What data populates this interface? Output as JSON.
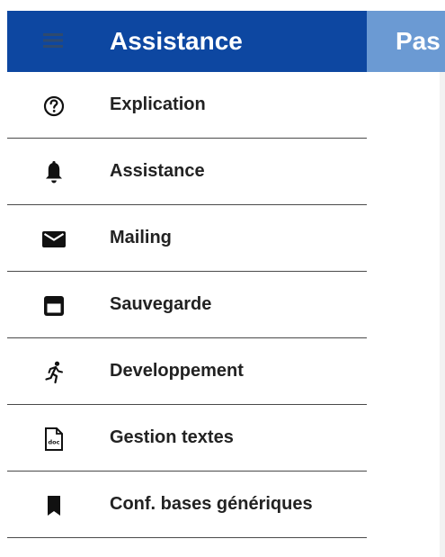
{
  "header": {
    "title": "Assistance",
    "menu_icon": "hamburger-icon",
    "color": "#0d47a1"
  },
  "appbar": {
    "partial_title": "Pas",
    "color": "#6b9ad3"
  },
  "menu": {
    "items": [
      {
        "label": "Explication",
        "icon": "help-circle-icon"
      },
      {
        "label": "Assistance",
        "icon": "bell-icon"
      },
      {
        "label": "Mailing",
        "icon": "envelope-icon"
      },
      {
        "label": "Sauvegarde",
        "icon": "save-icon"
      },
      {
        "label": "Developpement",
        "icon": "running-person-icon"
      },
      {
        "label": "Gestion textes",
        "icon": "doc-file-icon"
      },
      {
        "label": "Conf. bases génériques",
        "icon": "bookmark-icon"
      }
    ]
  }
}
